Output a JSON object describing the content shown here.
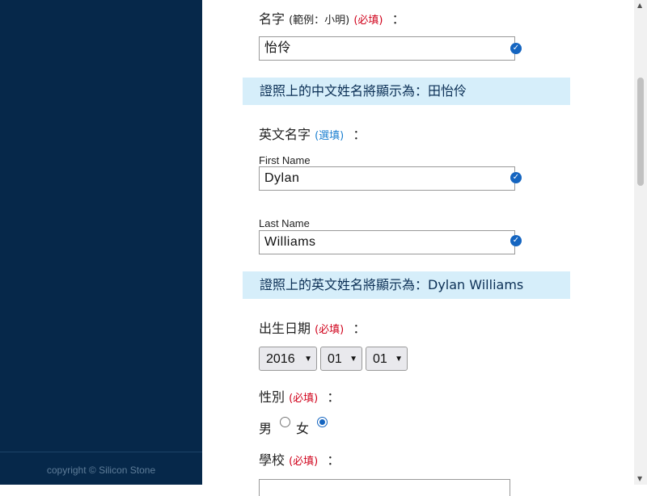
{
  "sidebar": {
    "footer": "copyright © Silicon Stone"
  },
  "form": {
    "first_name": {
      "label": "名字",
      "hint": "(範例：小明)",
      "required": "(必填)",
      "colon": "：",
      "value": "怡伶"
    },
    "chinese_preview": "證照上的中文姓名將顯示為：田怡伶",
    "english_name": {
      "label": "英文名字",
      "optional": "(選填)",
      "colon": "：",
      "first_label": "First Name",
      "first_value": "Dylan",
      "last_label": "Last Name",
      "last_value": "Williams"
    },
    "english_preview": "證照上的英文姓名將顯示為：Dylan Williams",
    "birthday": {
      "label": "出生日期",
      "required": "(必填)",
      "colon": "：",
      "year": "2016",
      "month": "01",
      "day": "01"
    },
    "gender": {
      "label": "性別",
      "required": "(必填)",
      "colon": "：",
      "male": "男",
      "female": "女",
      "selected": "女"
    },
    "school": {
      "label": "學校",
      "required": "(必填)",
      "colon": "："
    }
  },
  "icons": {
    "valid": "check-circle-icon"
  },
  "colors": {
    "sidebar_bg": "#06284a",
    "banner_bg": "#d6eefa",
    "required": "#d0021b",
    "optional": "#1a7fd0",
    "check": "#1565c0"
  }
}
